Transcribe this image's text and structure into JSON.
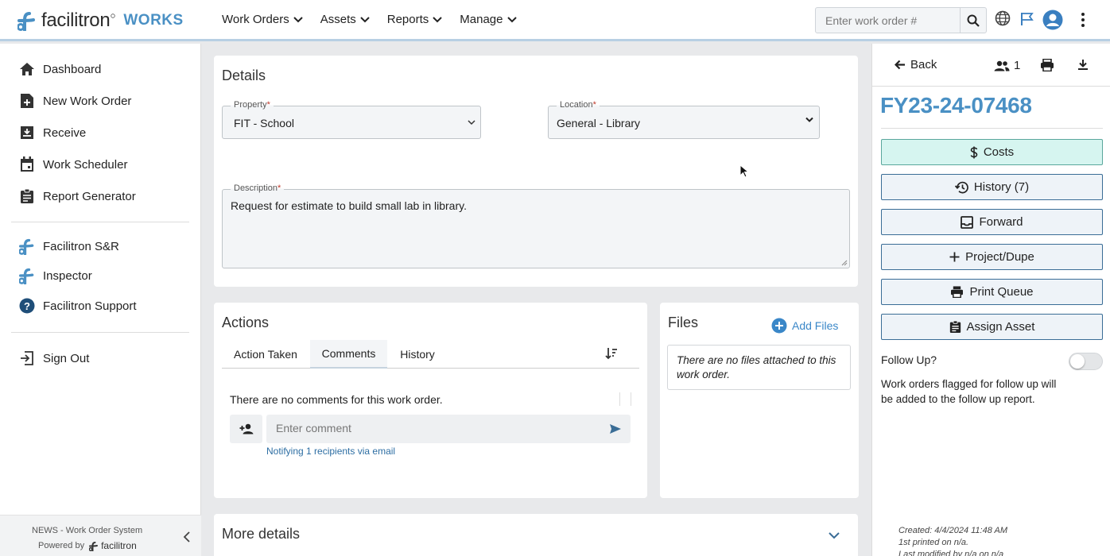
{
  "brand": {
    "name": "facilitron",
    "product": "WORKS"
  },
  "nav": {
    "items": [
      "Work Orders",
      "Assets",
      "Reports",
      "Manage"
    ]
  },
  "search": {
    "placeholder": "Enter work order #"
  },
  "sidebar": {
    "items": [
      {
        "label": "Dashboard",
        "icon": "home-icon"
      },
      {
        "label": "New Work Order",
        "icon": "file-plus-icon"
      },
      {
        "label": "Receive",
        "icon": "inbox-download-icon"
      },
      {
        "label": "Work Scheduler",
        "icon": "calendar-icon"
      },
      {
        "label": "Report Generator",
        "icon": "clipboard-icon"
      }
    ],
    "apps": [
      {
        "label": "Facilitron S&R",
        "icon": "facilitron-logo-icon"
      },
      {
        "label": "Inspector",
        "icon": "facilitron-logo-icon"
      },
      {
        "label": "Facilitron Support",
        "icon": "help-circle-icon"
      }
    ],
    "signout": "Sign Out",
    "footer_system": "NEWS - Work Order System",
    "footer_powered": "Powered by",
    "footer_brand": "facilitron"
  },
  "details": {
    "title": "Details",
    "property_label": "Property",
    "property_value": "FIT - School",
    "location_label": "Location",
    "location_value": "General - Library",
    "description_label": "Description",
    "description_value": "Request for estimate to build small lab in library.",
    "required_mark": "*"
  },
  "actions": {
    "title": "Actions",
    "tabs": [
      "Action Taken",
      "Comments",
      "History"
    ],
    "active_tab": "Comments",
    "empty": "There are no comments for this work order.",
    "comment_placeholder": "Enter comment",
    "notify": "Notifying 1 recipients via email"
  },
  "files": {
    "title": "Files",
    "add_label": "Add Files",
    "empty": "There are no files attached to this work order."
  },
  "more": {
    "title": "More details"
  },
  "rpanel": {
    "back": "Back",
    "people_count": "1",
    "wo_number": "FY23-24-07468",
    "buttons": [
      {
        "label": "Costs",
        "icon": "dollar-icon"
      },
      {
        "label": "History (7)",
        "icon": "history-icon"
      },
      {
        "label": "Forward",
        "icon": "inbox-icon"
      },
      {
        "label": "Project/Dupe",
        "icon": "plus-icon"
      },
      {
        "label": "Print Queue",
        "icon": "printer-icon"
      },
      {
        "label": "Assign Asset",
        "icon": "clipboard-icon"
      }
    ],
    "followup_label": "Follow Up?",
    "followup_on": false,
    "followup_help": "Work orders flagged for follow up will be added to the follow up report.",
    "created": "Created: 4/4/2024 11:48 AM",
    "printed": "1st printed on n/a.",
    "modified": "Last modified by n/a on n/a"
  },
  "colors": {
    "accent": "#4a90c4",
    "cost_bg": "#d6f5f0"
  }
}
